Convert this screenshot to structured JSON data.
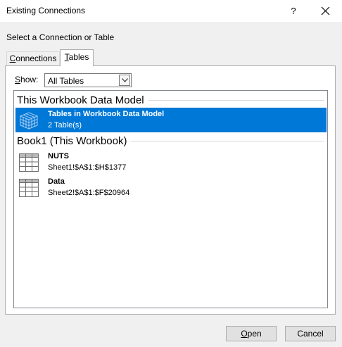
{
  "window": {
    "title": "Existing Connections",
    "help_label": "?"
  },
  "prompt": "Select a Connection or Table",
  "tabs": [
    {
      "label_pre": "C",
      "label_rest": "onnections",
      "active": false
    },
    {
      "label_pre": "T",
      "label_rest": "ables",
      "active": true
    }
  ],
  "show": {
    "label_pre": "S",
    "label_rest": "how:",
    "value": "All Tables"
  },
  "groups": [
    {
      "header": "This Workbook Data Model",
      "items": [
        {
          "name": "Tables in Workbook Data Model",
          "detail": "2 Table(s)",
          "icon": "data-model-cube-icon",
          "selected": true
        }
      ]
    },
    {
      "header": "Book1 (This Workbook)",
      "items": [
        {
          "name": "NUTS",
          "detail": "Sheet1!$A$1:$H$1377",
          "icon": "table-grid-icon",
          "selected": false
        },
        {
          "name": "Data",
          "detail": "Sheet2!$A$1:$F$20964",
          "icon": "table-grid-icon",
          "selected": false
        }
      ]
    }
  ],
  "buttons": {
    "open_pre": "O",
    "open_rest": "pen",
    "cancel": "Cancel"
  },
  "colors": {
    "selection": "#0078d7",
    "dialog_bg": "#f0f0f0"
  }
}
